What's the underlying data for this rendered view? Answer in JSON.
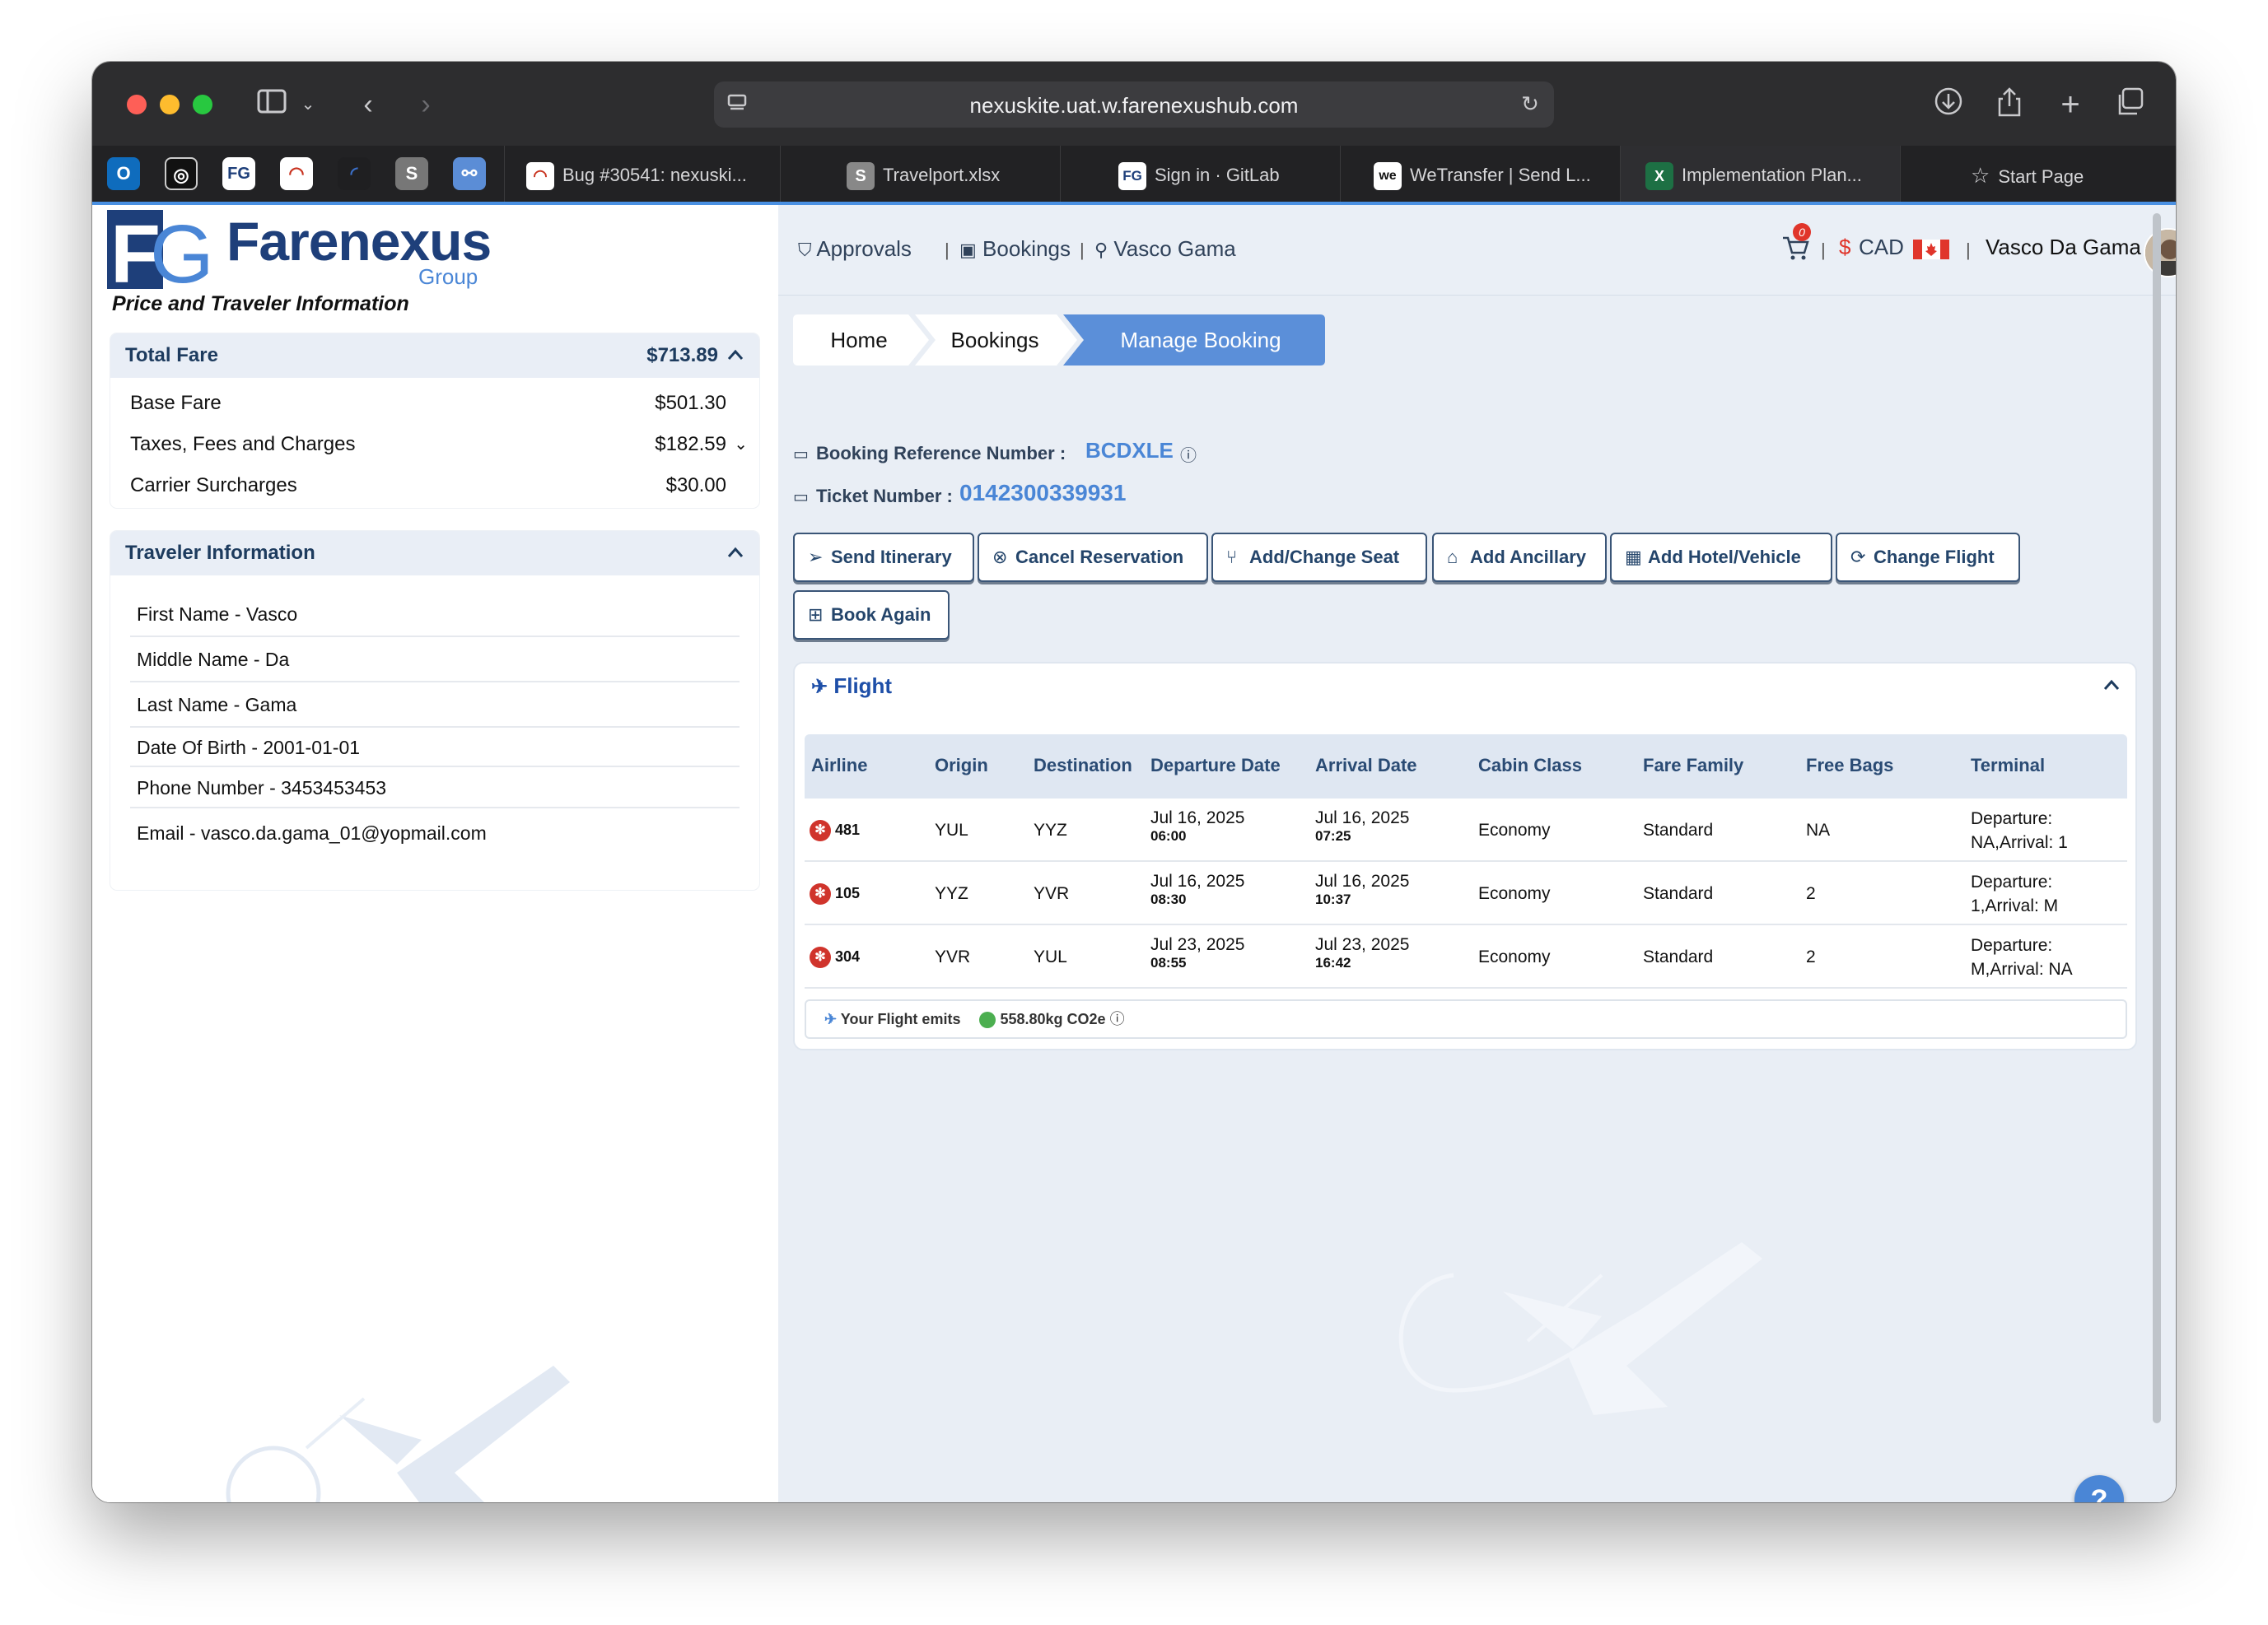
{
  "browser": {
    "url": "nexuskite.uat.w.farenexushub.com",
    "tabs": [
      {
        "label": "Bug #30541: nexuski..."
      },
      {
        "label": "Travelport.xlsx"
      },
      {
        "label": "Sign in · GitLab"
      },
      {
        "label": "WeTransfer | Send L..."
      },
      {
        "label": "Implementation Plan..."
      },
      {
        "label": "Start Page"
      }
    ]
  },
  "brand": {
    "logo_mark": "FG",
    "logo_name": "Farenexus",
    "logo_sub": "Group",
    "section_title": "Price and Traveler Information"
  },
  "fare": {
    "title": "Total Fare",
    "total": "$713.89",
    "rows": [
      {
        "label": "Base Fare",
        "value": "$501.30"
      },
      {
        "label": "Taxes, Fees and Charges",
        "value": "$182.59"
      },
      {
        "label": "Carrier Surcharges",
        "value": "$30.00"
      }
    ]
  },
  "traveler": {
    "title": "Traveler Information",
    "rows": [
      "First Name - Vasco",
      "Middle Name - Da",
      "Last Name - Gama",
      "Date Of Birth - 2001-01-01",
      "Phone Number - 3453453453",
      "Email - vasco.da.gama_01@yopmail.com"
    ]
  },
  "topnav": {
    "approvals": "Approvals",
    "bookings": "Bookings",
    "user_link": "Vasco Gama",
    "cart_count": "0",
    "currency_symbol": "$",
    "currency": "CAD",
    "user_name": "Vasco Da Gama"
  },
  "breadcrumb": [
    "Home",
    "Bookings",
    "Manage Booking"
  ],
  "booking": {
    "ref_label": "Booking Reference Number :",
    "ref_value": "BCDXLE",
    "ticket_label": "Ticket Number :",
    "ticket_value": "0142300339931"
  },
  "actions": [
    "Send Itinerary",
    "Cancel Reservation",
    "Add/Change Seat",
    "Add Ancillary",
    "Add Hotel/Vehicle",
    "Change Flight",
    "Book Again"
  ],
  "flight": {
    "title": "Flight",
    "columns": [
      "Airline",
      "Origin",
      "Destination",
      "Departure Date",
      "Arrival Date",
      "Cabin Class",
      "Fare Family",
      "Free Bags",
      "Terminal"
    ],
    "rows": [
      {
        "airline": "481",
        "origin": "YUL",
        "destination": "YYZ",
        "dep_date": "Jul 16, 2025",
        "dep_time": "06:00",
        "arr_date": "Jul 16, 2025",
        "arr_time": "07:25",
        "cabin": "Economy",
        "fare_family": "Standard",
        "bags": "NA",
        "terminal_1": "Departure:",
        "terminal_2": "NA,Arrival: 1"
      },
      {
        "airline": "105",
        "origin": "YYZ",
        "destination": "YVR",
        "dep_date": "Jul 16, 2025",
        "dep_time": "08:30",
        "arr_date": "Jul 16, 2025",
        "arr_time": "10:37",
        "cabin": "Economy",
        "fare_family": "Standard",
        "bags": "2",
        "terminal_1": "Departure:",
        "terminal_2": "1,Arrival: M"
      },
      {
        "airline": "304",
        "origin": "YVR",
        "destination": "YUL",
        "dep_date": "Jul 23, 2025",
        "dep_time": "08:55",
        "arr_date": "Jul 23, 2025",
        "arr_time": "16:42",
        "cabin": "Economy",
        "fare_family": "Standard",
        "bags": "2",
        "terminal_1": "Departure:",
        "terminal_2": "M,Arrival: NA"
      }
    ],
    "emit_label": "Your Flight emits",
    "emit_value": "558.80kg CO2e"
  },
  "help": "?",
  "colors": {
    "accent": "#4a86d6",
    "navy": "#1d3b5e",
    "airline_red": "#d0342c"
  },
  "icons": [
    "download-icon",
    "share-icon",
    "new-tab-icon",
    "tab-overview-icon",
    "cart-icon",
    "canada-flag-icon",
    "plane-icon",
    "leaf-icon",
    "info-icon"
  ]
}
